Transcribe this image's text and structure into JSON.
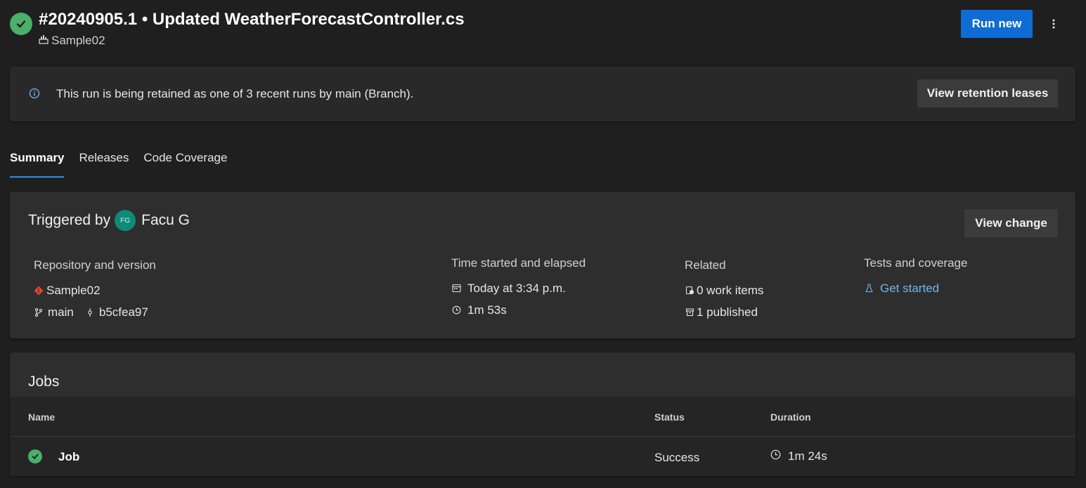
{
  "header": {
    "run_title": "#20240905.1 • Updated WeatherForecastController.cs",
    "pipeline_name": "Sample02",
    "run_new_label": "Run new",
    "status": "succeeded",
    "status_color": "#4caf6a"
  },
  "banner": {
    "text": "This run is being retained as one of 3 recent runs by main (Branch).",
    "button_label": "View retention leases"
  },
  "tabs": [
    {
      "label": "Summary",
      "active": true
    },
    {
      "label": "Releases",
      "active": false
    },
    {
      "label": "Code Coverage",
      "active": false
    }
  ],
  "summary": {
    "triggered_by_label": "Triggered by",
    "avatar_initials": "FG",
    "user_name": "Facu G",
    "view_change_label": "View change",
    "repository": {
      "heading": "Repository and version",
      "repo_name": "Sample02",
      "branch": "main",
      "commit": "b5cfea97"
    },
    "time": {
      "heading": "Time started and elapsed",
      "started": "Today at 3:34 p.m.",
      "elapsed": "1m 53s"
    },
    "related": {
      "heading": "Related",
      "work_items": "0 work items",
      "published": "1 published"
    },
    "tests": {
      "heading": "Tests and coverage",
      "link": "Get started"
    }
  },
  "jobs": {
    "title": "Jobs",
    "columns": [
      "Name",
      "Status",
      "Duration"
    ],
    "rows": [
      {
        "name": "Job",
        "status": "Success",
        "duration": "1m 24s"
      }
    ]
  },
  "colors": {
    "accent": "#0f6cd5",
    "link": "#6fb6f2",
    "success": "#4caf6a",
    "git": "#e8442a"
  }
}
